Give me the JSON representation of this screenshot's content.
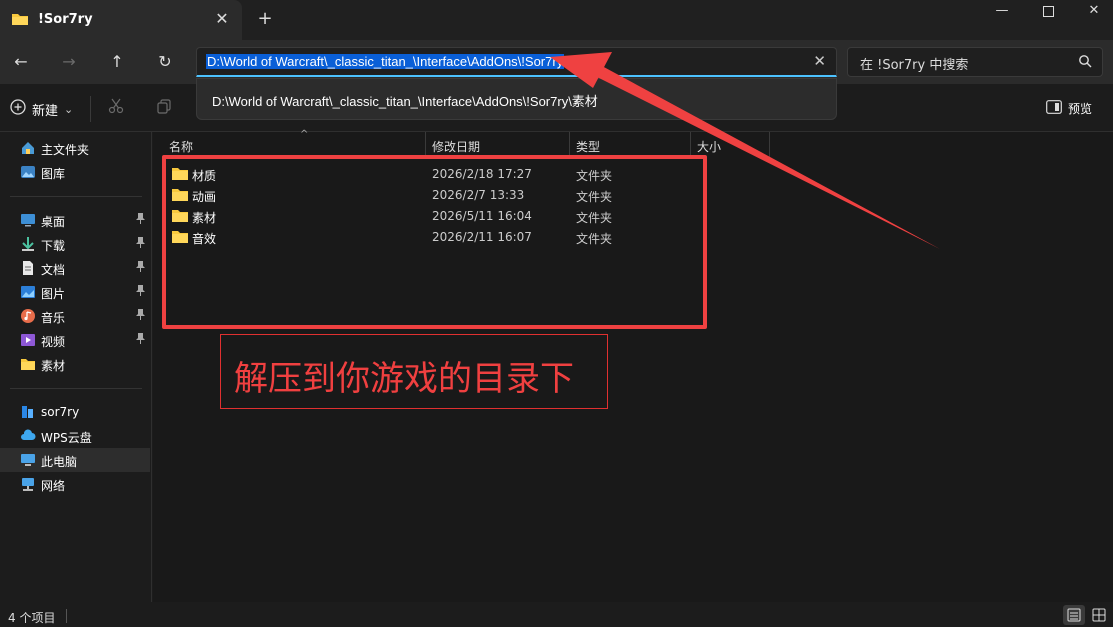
{
  "tab": {
    "title": "!Sor7ry",
    "close": "✕",
    "new": "+"
  },
  "window": {
    "minimize": "—",
    "maximize": "☐",
    "close": "✕"
  },
  "nav": {
    "back": "←",
    "forward": "→",
    "up": "↑",
    "refresh": "↻"
  },
  "address": {
    "value": "D:\\World of Warcraft\\_classic_titan_\\Interface\\AddOns\\!Sor7ry",
    "clear": "✕"
  },
  "autocomplete": {
    "item": "D:\\World of Warcraft\\_classic_titan_\\Interface\\AddOns\\!Sor7ry\\素材"
  },
  "search": {
    "placeholder": "在 !Sor7ry 中搜索"
  },
  "toolbar": {
    "new_label": "新建",
    "new_chevron": "⌄",
    "preview_label": "预览"
  },
  "sidebar": {
    "groups": [
      [
        {
          "label": "主文件夹",
          "icon": "home-icon"
        },
        {
          "label": "图库",
          "icon": "gallery-icon"
        }
      ],
      [
        {
          "label": "桌面",
          "icon": "desktop-icon",
          "pinned": true
        },
        {
          "label": "下载",
          "icon": "download-icon",
          "pinned": true
        },
        {
          "label": "文档",
          "icon": "document-icon",
          "pinned": true
        },
        {
          "label": "图片",
          "icon": "pictures-icon",
          "pinned": true
        },
        {
          "label": "音乐",
          "icon": "music-icon",
          "pinned": true
        },
        {
          "label": "视频",
          "icon": "video-icon",
          "pinned": true
        },
        {
          "label": "素材",
          "icon": "folder-icon",
          "pinned": false
        }
      ],
      [
        {
          "label": "sor7ry",
          "icon": "onedrive-icon"
        },
        {
          "label": "WPS云盘",
          "icon": "cloud-icon"
        },
        {
          "label": "此电脑",
          "icon": "this-pc-icon",
          "selected": true
        },
        {
          "label": "网络",
          "icon": "network-icon"
        }
      ]
    ]
  },
  "columns": {
    "name": "名称",
    "date": "修改日期",
    "type": "类型",
    "size": "大小",
    "sort_arrow": "^"
  },
  "files": [
    {
      "name": "材质",
      "date": "2026/2/18 17:27",
      "type": "文件夹"
    },
    {
      "name": "动画",
      "date": "2026/2/7 13:33",
      "type": "文件夹"
    },
    {
      "name": "素材",
      "date": "2026/5/11 16:04",
      "type": "文件夹"
    },
    {
      "name": "音效",
      "date": "2026/2/11 16:07",
      "type": "文件夹"
    }
  ],
  "annotation": {
    "callout": "解压到你游戏的目录下",
    "color": "#ef4141"
  },
  "status": {
    "count": "4 个项目"
  },
  "colors": {
    "folder": "#f8c93e",
    "accent": "#4cc2ff",
    "selection": "#0a5fd7"
  }
}
